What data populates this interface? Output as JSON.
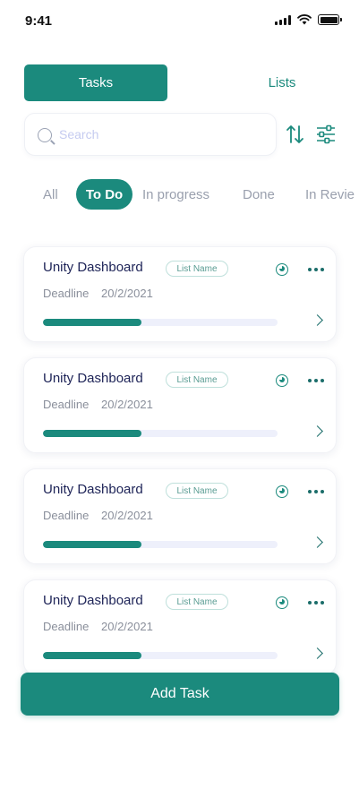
{
  "status_bar": {
    "time": "9:41"
  },
  "segment": {
    "tasks_label": "Tasks",
    "lists_label": "Lists",
    "active": "Tasks"
  },
  "search": {
    "placeholder": "Search",
    "value": ""
  },
  "filters": {
    "items": [
      "All",
      "To Do",
      "In progress",
      "Done",
      "In Revie"
    ],
    "active": "To Do"
  },
  "tasks": [
    {
      "title": "Unity Dashboard",
      "list_name": "List Name",
      "deadline_label": "Deadline",
      "deadline": "20/2/2021",
      "progress": 0.42
    },
    {
      "title": "Unity Dashboard",
      "list_name": "List Name",
      "deadline_label": "Deadline",
      "deadline": "20/2/2021",
      "progress": 0.42
    },
    {
      "title": "Unity Dashboard",
      "list_name": "List Name",
      "deadline_label": "Deadline",
      "deadline": "20/2/2021",
      "progress": 0.42
    },
    {
      "title": "Unity Dashboard",
      "list_name": "List Name",
      "deadline_label": "Deadline",
      "deadline": "20/2/2021",
      "progress": 0.42
    }
  ],
  "add_task_label": "Add Task",
  "colors": {
    "accent": "#1b8a7d",
    "title": "#1d2357",
    "muted": "#9aa0ae",
    "track": "#eef0fb"
  },
  "icons": {
    "search": "search-icon",
    "sort": "sort-icon",
    "filter": "filter-sliders-icon",
    "timer": "clock-icon",
    "menu": "more-dots-icon",
    "open": "chevron-right-icon"
  }
}
